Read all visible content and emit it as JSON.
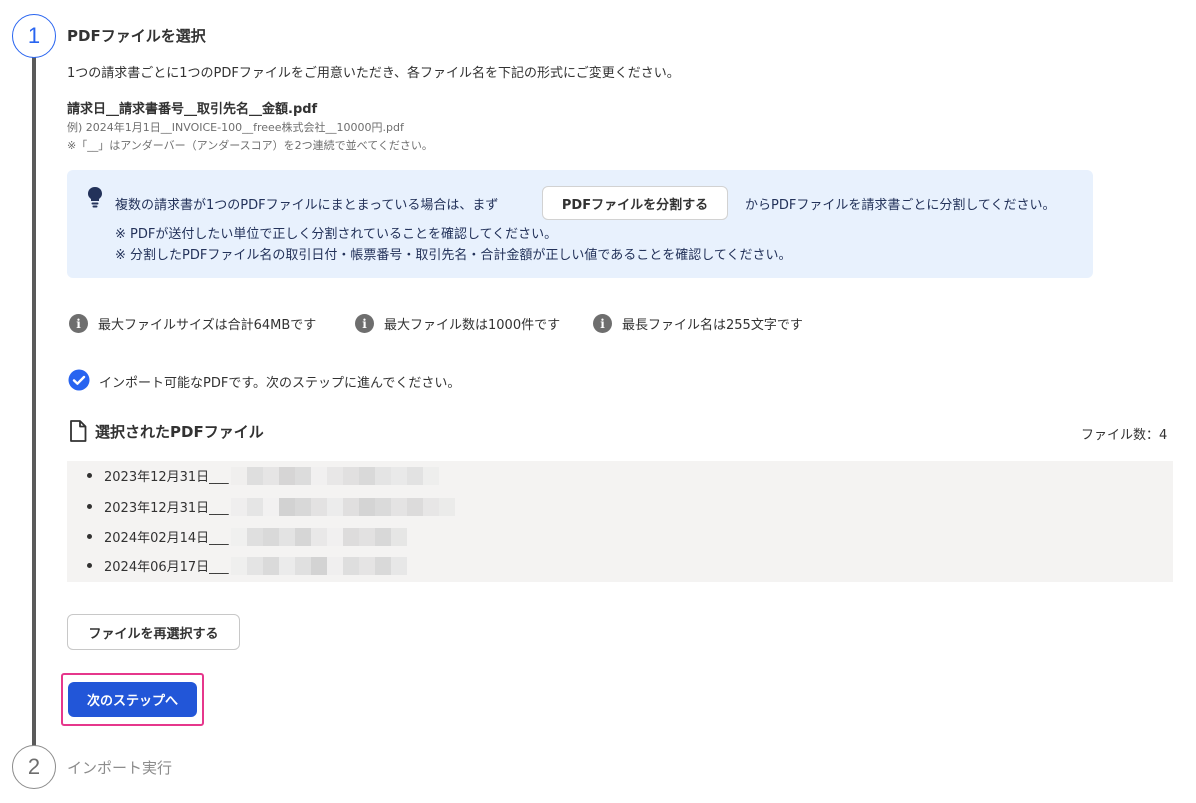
{
  "step1": {
    "number": "1",
    "title": "PDFファイルを選択",
    "description": "1つの請求書ごとに1つのPDFファイルをご用意いただき、各ファイル名を下記の形式にご変更ください。",
    "format": "請求日__請求書番号__取引先名__金額.pdf",
    "example": "例) 2024年1月1日__INVOICE-100__freee株式会社__10000円.pdf",
    "note": "※「__」はアンダーバー（アンダースコア）を2つ連続で並べてください。"
  },
  "info_box": {
    "text_before": "複数の請求書が1つのPDFファイルにまとまっている場合は、まず",
    "split_button": "PDFファイルを分割する",
    "text_after": "からPDFファイルを請求書ごとに分割してください。",
    "note1": "※ PDFが送付したい単位で正しく分割されていることを確認してください。",
    "note2": "※ 分割したPDFファイル名の取引日付・帳票番号・取引先名・合計金額が正しい値であることを確認してください。"
  },
  "limits": [
    "最大ファイルサイズは合計64MBです",
    "最大ファイル数は1000件です",
    "最長ファイル名は255文字です"
  ],
  "status": {
    "text": "インポート可能なPDFです。次のステップに進んでください。",
    "icon": "check-circle-icon",
    "color": "#2864f0"
  },
  "selected": {
    "title": "選択されたPDFファイル",
    "count_label": "ファイル数：4",
    "files": [
      "2023年12月31日___",
      "2023年12月31日___",
      "2024年02月14日___",
      "2024年06月17日___"
    ]
  },
  "reselect_button": "ファイルを再選択する",
  "next_button": "次のステップへ",
  "step2": {
    "number": "2",
    "title": "インポート実行"
  },
  "colors": {
    "accent": "#2864f0",
    "info_bg": "#e8f1fd",
    "highlight": "#e6378c"
  }
}
